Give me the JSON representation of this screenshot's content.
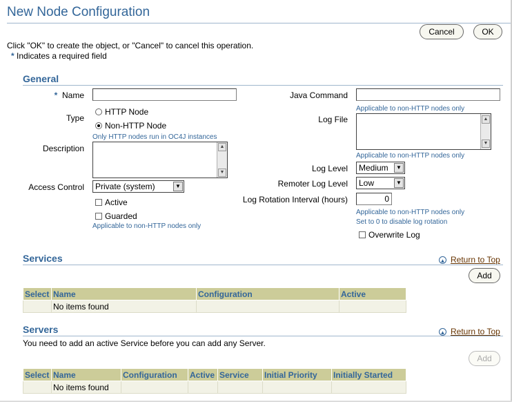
{
  "page": {
    "title": "New Node Configuration",
    "instructions": "Click \"OK\" to create the object, or \"Cancel\" to cancel this operation.",
    "required_note": "Indicates a required field",
    "cancel_label": "Cancel",
    "ok_label": "OK",
    "required_marker": "*"
  },
  "general": {
    "title": "General",
    "name_label": "Name",
    "name_value": "",
    "type_label": "Type",
    "type_options": [
      "HTTP Node",
      "Non-HTTP Node"
    ],
    "type_selected": "Non-HTTP Node",
    "type_hint": "Only HTTP nodes run in OC4J instances",
    "description_label": "Description",
    "access_control_label": "Access Control",
    "access_control_value": "Private (system)",
    "active_label": "Active",
    "guarded_label": "Guarded",
    "checkbox_hint": "Applicable to non-HTTP nodes only",
    "java_command_label": "Java Command",
    "java_command_hint": "Applicable to non-HTTP nodes only",
    "log_file_label": "Log File",
    "log_file_hint": "Applicable to non-HTTP nodes only",
    "log_level_label": "Log Level",
    "log_level_value": "Medium",
    "remoter_log_level_label": "Remoter Log Level",
    "remoter_log_level_value": "Low",
    "log_rotation_label": "Log Rotation Interval (hours)",
    "log_rotation_value": "0",
    "log_rotation_hint1": "Applicable to non-HTTP nodes only",
    "log_rotation_hint2": "Set to 0 to disable log rotation",
    "overwrite_log_label": "Overwrite Log"
  },
  "services": {
    "title": "Services",
    "return_to_top": "Return to Top",
    "add_label": "Add",
    "columns": [
      "Select",
      "Name",
      "Configuration",
      "Active"
    ],
    "empty_text": "No items found"
  },
  "servers": {
    "title": "Servers",
    "return_to_top": "Return to Top",
    "note": "You need to add an active Service before you can add any Server.",
    "add_label": "Add",
    "columns": [
      "Select",
      "Name",
      "Configuration",
      "Active",
      "Service",
      "Initial Priority",
      "Initially Started"
    ],
    "empty_text": "No items found"
  }
}
